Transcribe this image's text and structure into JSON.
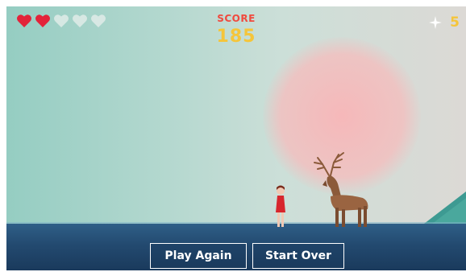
{
  "hud": {
    "lives": {
      "max": 5,
      "remaining": 2
    },
    "score_label": "SCORE",
    "score_value": "185",
    "coins": "5",
    "sparkle_icon": "sparkle-icon",
    "heart_icon": "heart-icon"
  },
  "buttons": {
    "play_again": "Play Again",
    "start_over": "Start Over"
  },
  "colors": {
    "heart_full": "#e3233a",
    "heart_empty": "#e8efec",
    "score_label": "#f04a3e",
    "score_value": "#f5c53a",
    "ground": "#234a70",
    "sun": "#f5b9bb"
  }
}
